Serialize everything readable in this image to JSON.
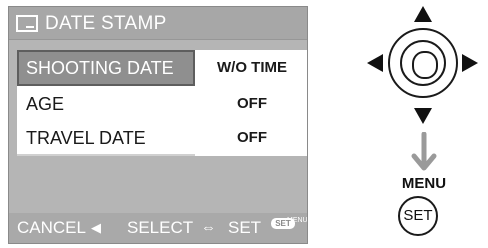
{
  "menu": {
    "title": "DATE STAMP",
    "title_icon": "date-stamp-icon",
    "rows": [
      {
        "label": "SHOOTING DATE",
        "value": "W/O TIME",
        "selected": true
      },
      {
        "label": "AGE",
        "value": "OFF",
        "selected": false
      },
      {
        "label": "TRAVEL DATE",
        "value": "OFF",
        "selected": false
      }
    ]
  },
  "footer": {
    "cancel": "CANCEL",
    "cancel_arrow": "◀",
    "select": "SELECT",
    "select_arrow": "⇔",
    "set": "SET",
    "badge_top": "MENU",
    "badge_bottom": "SET"
  },
  "controls": {
    "menu_label": "MENU",
    "set_label": "SET"
  },
  "colors": {
    "screen_bg": "#b5b5b5",
    "selected_row": "#8f8f8f",
    "text_light": "#ffffff"
  }
}
